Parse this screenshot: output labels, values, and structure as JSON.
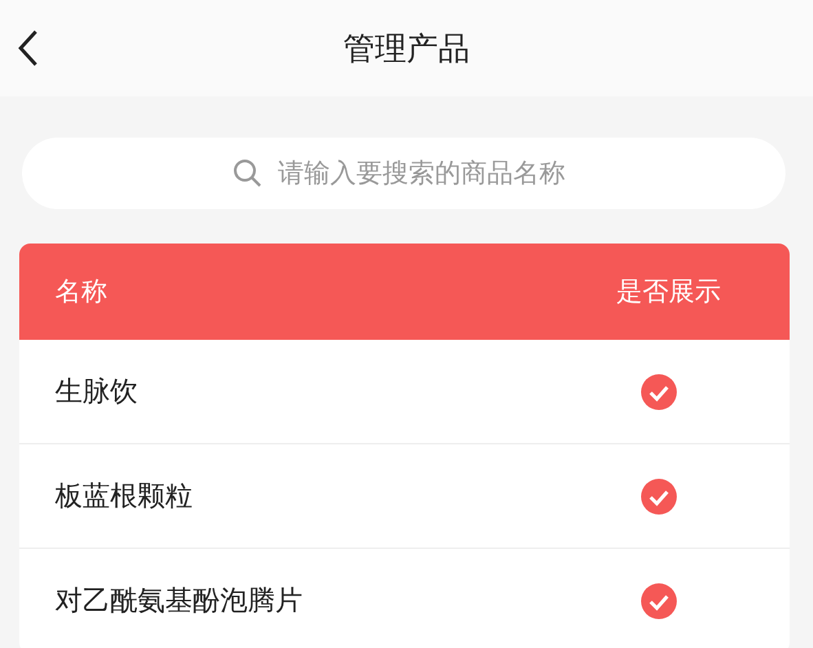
{
  "header": {
    "title": "管理产品"
  },
  "search": {
    "placeholder": "请输入要搜索的商品名称"
  },
  "table": {
    "columns": [
      "名称",
      "是否展示"
    ],
    "rows": [
      {
        "name": "生脉饮",
        "shown": true
      },
      {
        "name": "板蓝根颗粒",
        "shown": true
      },
      {
        "name": "对乙酰氨基酚泡腾片",
        "shown": true
      }
    ]
  }
}
